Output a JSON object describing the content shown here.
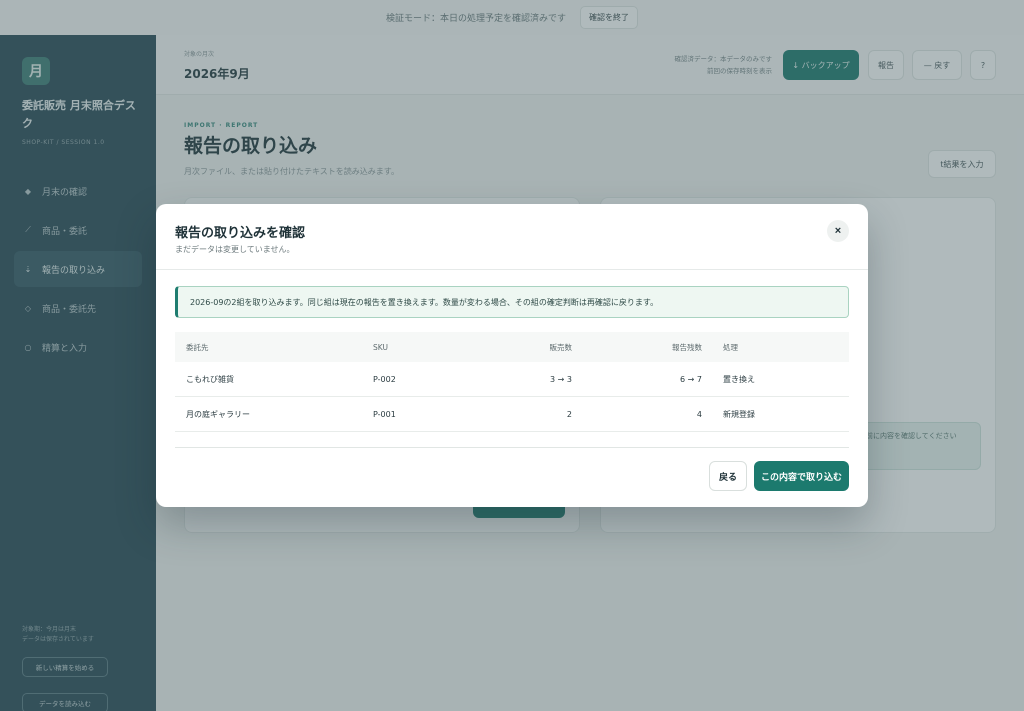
{
  "topbar": {
    "message": "検証モード：本日の処理予定を確認済みです",
    "button": "確認を終了"
  },
  "sidebar": {
    "logo": "月",
    "app_name": "委託販売 月末照合デスク",
    "sub": "SHOP-KIT / SESSION 1.0",
    "items": [
      {
        "icon": "◆",
        "label": "月末の確認"
      },
      {
        "icon": "⟋",
        "label": "商品・委託"
      },
      {
        "icon": "⇣",
        "label": "報告の取り込み"
      },
      {
        "icon": "◇",
        "label": "商品・委託先"
      },
      {
        "icon": "○",
        "label": "精算と入力"
      }
    ],
    "footer": "対象期：今月は月末\nデータは保存されています",
    "footer_btn1": "新しい精算を始める",
    "footer_btn2": "データを読み込む"
  },
  "header": {
    "label": "対象の月次",
    "month": "2026年9月",
    "status_line1": "確認済データ：本データのみです",
    "status_line2": "前回の保存時刻を表示",
    "backup": "↓ バックアップ",
    "btn_a": "報告",
    "btn_b": "— 戻す",
    "btn_c": "?"
  },
  "page": {
    "kicker": "IMPORT · REPORT",
    "title": "報告の取り込み",
    "desc": "月次ファイル、または貼り付けたテキストを読み込みます。",
    "right_btn": "t結果を入力",
    "card_note": "取り込む前に内容を確認してください"
  },
  "modal": {
    "title": "報告の取り込みを確認",
    "subtitle": "まだデータは変更していません。",
    "close_label": "×",
    "notice": "2026-09の2組を取り込みます。同じ組は現在の報告を置き換えます。数量が変わる場合、その組の確定判断は再確認に戻ります。",
    "table": {
      "headers": [
        "委託先",
        "SKU",
        "販売数",
        "報告残数",
        "処理"
      ],
      "rows": [
        [
          "こもれび雑貨",
          "P-002",
          "3 → 3",
          "6 → 7",
          "置き換え"
        ],
        [
          "月の庭ギャラリー",
          "P-001",
          "2",
          "4",
          "新規登録"
        ]
      ]
    },
    "back_label": "戻る",
    "confirm_label": "この内容で取り込む"
  },
  "colors": {
    "accent": "#1c7a6e",
    "sidebar": "#2a4a57"
  }
}
